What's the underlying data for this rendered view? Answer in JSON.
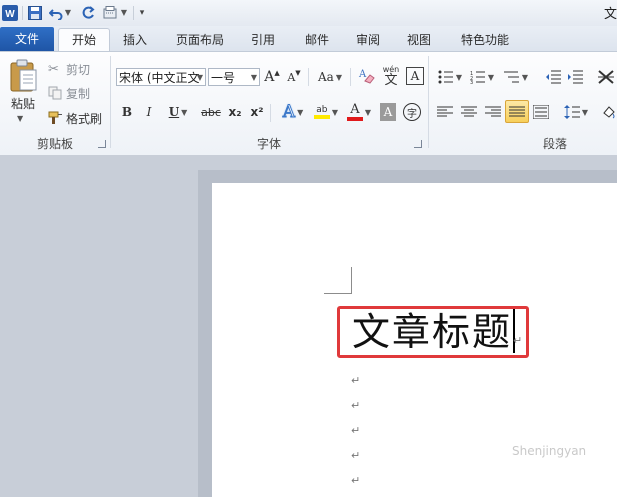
{
  "window": {
    "title_fragment": "文"
  },
  "quick_access": {
    "customize_label": "▾"
  },
  "tabs": [
    {
      "label": "文件"
    },
    {
      "label": "开始"
    },
    {
      "label": "插入"
    },
    {
      "label": "页面布局"
    },
    {
      "label": "引用"
    },
    {
      "label": "邮件"
    },
    {
      "label": "审阅"
    },
    {
      "label": "视图"
    },
    {
      "label": "特色功能"
    }
  ],
  "clipboard": {
    "paste_label": "粘贴",
    "cut_label": "剪切",
    "copy_label": "复制",
    "format_painter_label": "格式刷",
    "group_label": "剪贴板"
  },
  "font": {
    "font_name": "宋体 (中文正文",
    "font_size": "一号",
    "grow_label": "A",
    "shrink_label": "A",
    "case_label": "Aa",
    "phonetic_label": "wén",
    "border_char_label": "A",
    "bold_label": "B",
    "italic_label": "I",
    "underline_label": "U",
    "strike_label": "abc",
    "subscript_label": "x₂",
    "superscript_label": "x²",
    "effects_label": "A",
    "highlight_label": "ab",
    "font_color_label": "A",
    "shading_label": "A",
    "enclose_label": "字",
    "group_label": "字体",
    "font_color": "#e0191b",
    "highlight_color": "#ffea00"
  },
  "paragraph": {
    "group_label": "段落"
  },
  "document": {
    "title_text": "文章标题",
    "return_mark": "↵",
    "watermark": "Shenjingyan"
  },
  "colors": {
    "file_tab": "#2a64b8",
    "highlight_box": "#e0393b"
  }
}
